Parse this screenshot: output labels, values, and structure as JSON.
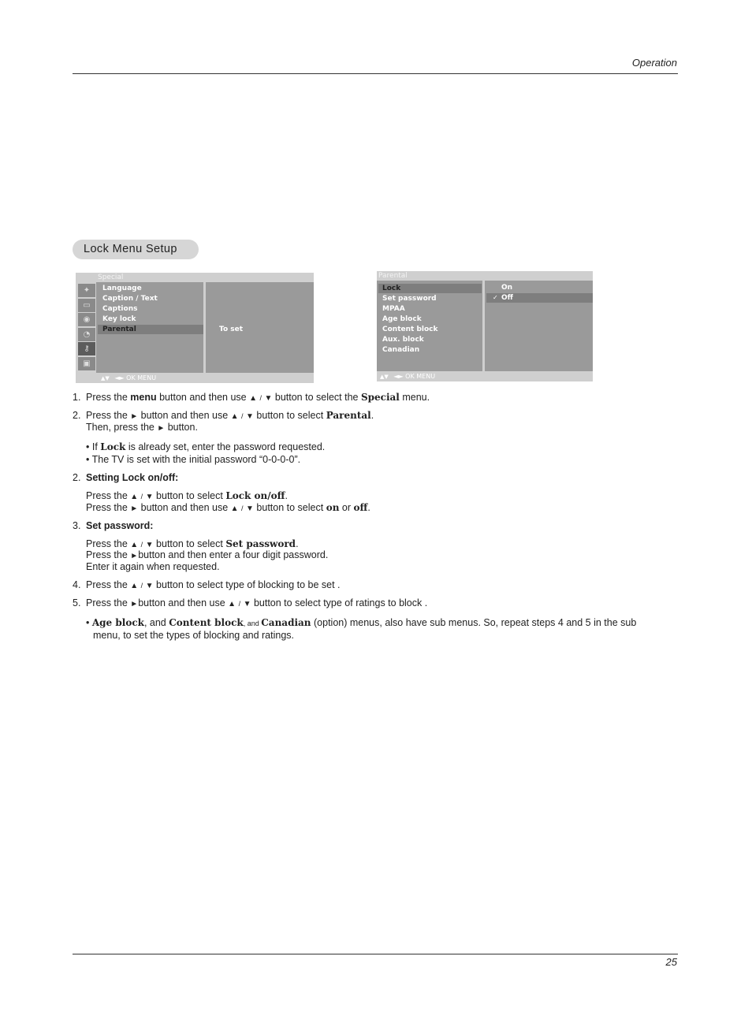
{
  "header": {
    "section": "Operation"
  },
  "footer": {
    "page_number": "25"
  },
  "section_title": "Lock Menu Setup",
  "osd_special": {
    "title": "Special",
    "icons": [
      "satellite-dish-icon",
      "picture-icon",
      "speaker-icon",
      "clock-icon",
      "key-icon",
      "pc-monitor-icon"
    ],
    "icon_glyphs": [
      "✦",
      "▭",
      "◉",
      "◔",
      "⚷",
      "▣"
    ],
    "items": [
      "Language",
      "Caption / Text",
      "Captions",
      "Key lock",
      "Parental"
    ],
    "selected_index": 4,
    "right_text": "To set",
    "footer": "◄► OK   MENU",
    "updown": "▲▼"
  },
  "osd_parental": {
    "title": "Parental",
    "items": [
      "Lock",
      "Set password",
      "MPAA",
      "Age block",
      "Content block",
      "Aux. block",
      "Canadian"
    ],
    "selected_index": 0,
    "options": [
      "On",
      "Off"
    ],
    "checked_option": "Off",
    "check_mark": "✓",
    "footer": "◄► OK   MENU",
    "updown": "▲▼"
  },
  "glyphs": {
    "up": "▲",
    "down": "▼",
    "right": "►",
    "slash": "/"
  },
  "steps": {
    "s1": {
      "num": "1.",
      "t1": "Press the ",
      "b1": "menu",
      "t2": " button and then use ",
      "t3": " button to select the ",
      "b2": "Special",
      "t4": " menu."
    },
    "s2": {
      "num": "2.",
      "t1": "Press the ",
      "t2": " button and then use ",
      "t3": " button to select ",
      "b1": "Parental",
      "t4": ".",
      "line2a": "Then, press the ",
      "line2b": " button."
    },
    "note1": {
      "t1": "• If ",
      "b1": "Lock",
      "t2": " is already set, enter the password requested."
    },
    "note2": "• The TV is set with the initial password “0-0-0-0”.",
    "s2b": {
      "num": "2.",
      "heading": "Setting Lock on/off:",
      "l1a": "Press the ",
      "l1b": " button to select ",
      "l1c": "Lock on/off",
      "l1d": ".",
      "l2a": "Press the ",
      "l2b": " button and then use ",
      "l2c": " button to select ",
      "l2d": "on",
      "l2e": " or ",
      "l2f": "off",
      "l2g": "."
    },
    "s3": {
      "num": "3.",
      "heading": "Set password:",
      "l1a": "Press the ",
      "l1b": " button to select ",
      "l1c": "Set password",
      "l1d": ".",
      "l2a": "Press the ",
      "l2b": "button and then enter a four digit password.",
      "l3": "Enter it again when requested."
    },
    "s4": {
      "num": "4.",
      "t1": "Press the ",
      "t2": " button to select type of blocking to be set ."
    },
    "s5": {
      "num": "5.",
      "t1": "Press the ",
      "t2": "button and then use ",
      "t3": " button to select type of ratings to block ."
    },
    "note3": {
      "t0": "• ",
      "b1": "Age block",
      "t1": ", and ",
      "b2": "Content block",
      "t2": ", and ",
      "b3": "Canadian",
      "t3": " (option) menus, also have sub menus. So, repeat steps 4 and 5 in the sub",
      "line2": "menu, to set the types of blocking and ratings."
    }
  }
}
